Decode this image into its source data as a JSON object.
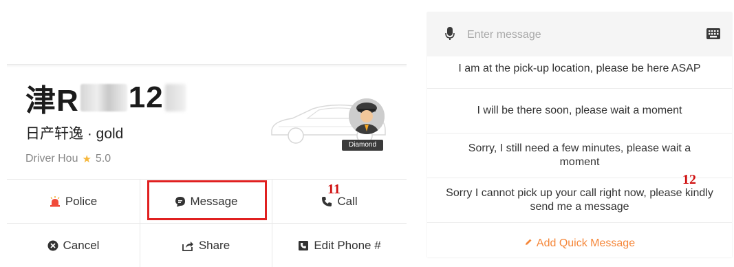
{
  "driver_card": {
    "plate_prefix": "津R",
    "plate_suffix": "12",
    "car_model": "日产轩逸 · gold",
    "driver_name": "Driver Hou",
    "rating": "5.0",
    "badge": "Diamond"
  },
  "actions": {
    "police": "Police",
    "message": "Message",
    "call": "Call",
    "cancel": "Cancel",
    "share": "Share",
    "edit_phone": "Edit Phone #"
  },
  "annotations": {
    "left_marker": "11",
    "right_marker": "12"
  },
  "quick_message": {
    "placeholder": "Enter message",
    "items": [
      "I am at the pick-up location, please be here ASAP",
      "I will be there soon, please wait a moment",
      "Sorry, I still need a few minutes, please wait a moment",
      "Sorry I cannot pick up your call right now, please kindly send me a message"
    ],
    "add_label": "Add Quick Message"
  },
  "colors": {
    "accent_orange": "#f5873a",
    "highlight_red": "#e02020",
    "police_red": "#f04a3a",
    "star_yellow": "#f6b73c"
  },
  "icons": [
    "police-light-icon",
    "message-icon",
    "phone-icon",
    "cancel-icon",
    "share-icon",
    "phone-book-icon",
    "microphone-icon",
    "keyboard-icon",
    "pencil-icon",
    "star-icon"
  ]
}
